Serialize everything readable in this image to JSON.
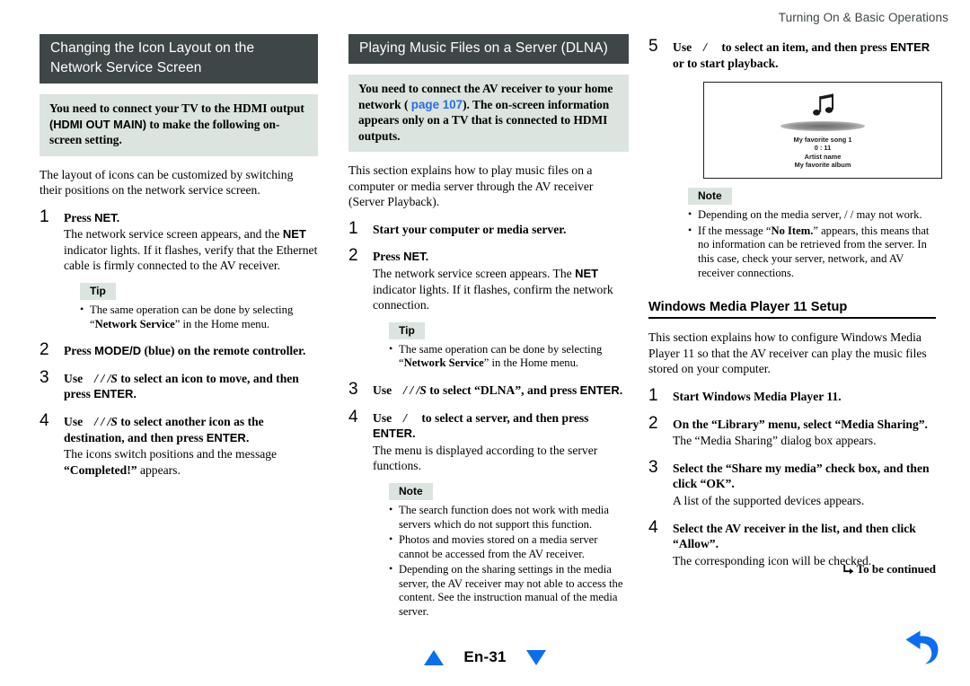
{
  "running_head": "Turning On & Basic Operations",
  "left_column": {
    "section_title": "Changing the Icon Layout on the Network Service Screen",
    "callout": {
      "text_before": "You need to connect your TV to the HDMI output ",
      "sans_part": "(HDMI OUT MAIN)",
      "text_after": " to make the following on-screen setting."
    },
    "intro": "The layout of icons can be customized by switching their positions on the network service screen.",
    "steps": [
      {
        "num": "1",
        "head_plain": "Press ",
        "head_sans": "NET.",
        "detail_1": "The network service screen appears, and the ",
        "detail_b": "NET",
        "detail_2": " indicator lights. If it flashes, verify that the Ethernet cable is firmly connected to the AV receiver."
      },
      {
        "num": "2",
        "head_plain": "Press ",
        "head_sans": "MODE/D",
        "head_tail": " (blue) on the remote controller."
      },
      {
        "num": "3",
        "head_use": "Use",
        "head_keys": "/  /  /S",
        "head_mid": " to select an icon to move, and then press ",
        "head_sans": "ENTER."
      },
      {
        "num": "4",
        "head_use": "Use",
        "head_keys": "/  /  /S",
        "head_mid": " to select another icon as the destination, and then press ",
        "head_sans": "ENTER.",
        "detail_1": "The icons switch positions and the message ",
        "detail_b": "“Completed!”",
        "detail_2": " appears."
      }
    ],
    "tip": {
      "tag": "Tip",
      "bullets": [
        {
          "pre": "The same operation can be done by selecting “",
          "b": "Network Service",
          "post": "” in the Home menu."
        }
      ]
    }
  },
  "mid_column": {
    "section_title": "Playing Music Files on a Server (DLNA)",
    "callout": {
      "text_before": "You need to connect the AV receiver to your home network ( ",
      "link": "page 107",
      "text_after": "). The on-screen information appears only on a TV that is connected to HDMI outputs."
    },
    "intro": "This section explains how to play music files on a computer or media server through the AV receiver (Server Playback).",
    "steps": [
      {
        "num": "1",
        "head_plain": "Start your computer or media server."
      },
      {
        "num": "2",
        "head_plain": "Press ",
        "head_sans": "NET.",
        "detail_1": "The network service screen appears. The ",
        "detail_b": "NET",
        "detail_2": " indicator lights. If it flashes, confirm the network connection."
      },
      {
        "num": "3",
        "head_use": "Use",
        "head_keys": "/  /  /S",
        "head_mid": " to select “DLNA”, and press ",
        "head_sans": "ENTER."
      },
      {
        "num": "4",
        "head_use": "Use",
        "head_keys": "/",
        "head_mid": " to select a server, and then press ",
        "head_sans": "ENTER.",
        "detail_1": "The menu is displayed according to the server functions."
      }
    ],
    "tip": {
      "tag": "Tip",
      "bullets": [
        {
          "pre": "The same operation can be done by selecting “",
          "b": "Network Service",
          "post": "” in the Home menu."
        }
      ]
    },
    "note": {
      "tag": "Note",
      "bullets": [
        {
          "pre": "The search function does not work with media servers which do not support this function.",
          "b": "",
          "post": ""
        },
        {
          "pre": "Photos and movies stored on a media server cannot be accessed from the AV receiver.",
          "b": "",
          "post": ""
        },
        {
          "pre": "Depending on the sharing settings in the media server, the AV receiver may not able to access the content. See the instruction manual of the media server.",
          "b": "",
          "post": ""
        }
      ]
    }
  },
  "right_column": {
    "step5": {
      "num": "5",
      "head_use": "Use",
      "head_keys": "/",
      "head_mid": " to select an item, and then press ",
      "head_sans": "ENTER",
      "head_tail": " or to start playback."
    },
    "tv_screen": {
      "icon": "music-note-icon",
      "line1": "My favorite song 1",
      "line2": "0 : 11",
      "line3": "Artist name",
      "line4": "My favorite album"
    },
    "note": {
      "tag": "Note",
      "bullets": [
        {
          "pre": "Depending on the media server,       /       /       may not work.",
          "b": "",
          "post": ""
        },
        {
          "pre": "If the message “",
          "b": "No Item.",
          "post": "” appears, this means that no information can be retrieved from the server. In this case, check your server, network, and AV receiver connections."
        }
      ]
    },
    "subhead": "Windows Media Player 11 Setup",
    "intro": "This section explains how to configure Windows Media Player 11 so that the AV receiver can play the music files stored on your computer.",
    "steps": [
      {
        "num": "1",
        "head_plain": "Start Windows Media Player 11."
      },
      {
        "num": "2",
        "head_plain": "On the “Library” menu, select “Media Sharing”.",
        "detail_1": "The “Media Sharing” dialog box appears."
      },
      {
        "num": "3",
        "head_plain": "Select the “Share my media” check box, and then click “OK”.",
        "detail_1": "A list of the supported devices appears."
      },
      {
        "num": "4",
        "head_plain": "Select the AV receiver in the list, and then click “Allow”.",
        "detail_1": "The corresponding icon will be checked."
      }
    ]
  },
  "footer": {
    "continued": "To be continued",
    "page_label": "En-31",
    "prev_icon": "triangle-up-icon",
    "next_icon": "triangle-down-icon",
    "return_icon": "return-arrow-icon"
  },
  "colors": {
    "title_bar": "#3f4648",
    "callout_bg": "#dbe4df",
    "link": "#2b6ee0",
    "nav_blue": "#0a6ef0"
  }
}
